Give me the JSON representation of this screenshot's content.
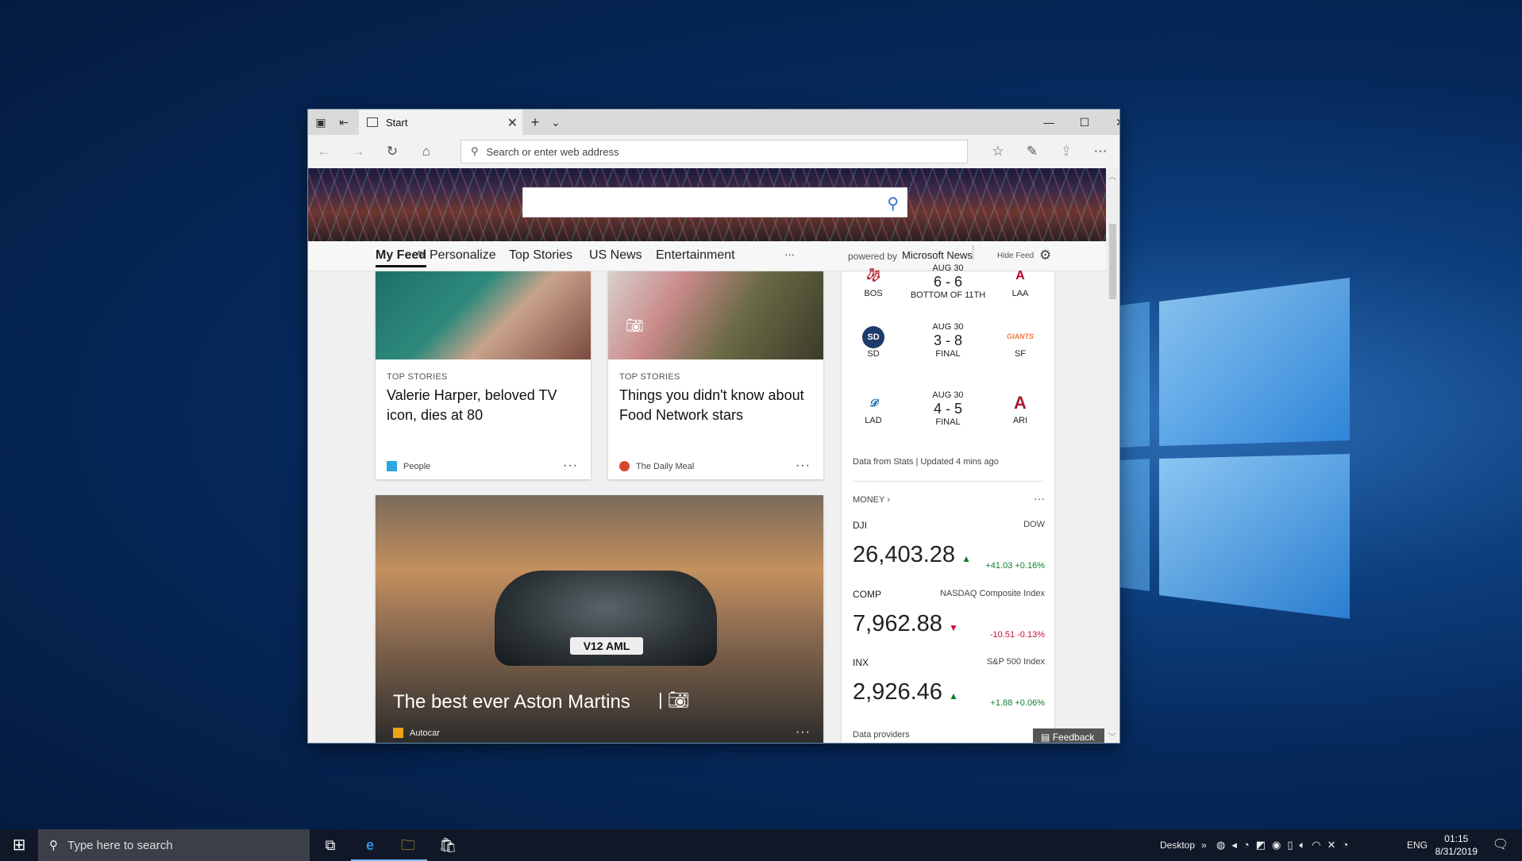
{
  "browser": {
    "tab_title": "Start",
    "address_placeholder": "Search or enter web address",
    "icons": [
      "set-aside-tabs-icon",
      "restore-tabs-icon",
      "new-tab-icon",
      "tab-list-icon",
      "back-icon",
      "forward-icon",
      "refresh-icon",
      "home-icon",
      "favorites-icon",
      "pen-icon",
      "share-icon",
      "more-icon"
    ]
  },
  "feed_nav": {
    "items": [
      "My Feed",
      "Personalize",
      "Top Stories",
      "US News",
      "Entertainment",
      "···"
    ],
    "powered_by": "powered by",
    "brand": "Microsoft News",
    "hide_feed": "Hide Feed"
  },
  "articles": [
    {
      "category": "TOP STORIES",
      "title": "Valerie Harper, beloved TV icon, dies at 80",
      "source": "People"
    },
    {
      "category": "TOP STORIES",
      "title": "Things you didn't know about Food Network stars",
      "source": "The Daily Meal"
    },
    {
      "title": "The best ever Aston Martins",
      "source": "Autocar",
      "plate": "V12 AML"
    }
  ],
  "scores": {
    "games": [
      {
        "away": "BOS",
        "date": "AUG 30",
        "score": "6 - 6",
        "status": "BOTTOM OF 11TH",
        "home": "LAA"
      },
      {
        "away": "SD",
        "date": "AUG 30",
        "score": "3 - 8",
        "status": "FINAL",
        "home": "SF",
        "home_logo_text": "GIANTS"
      },
      {
        "away": "LAD",
        "date": "AUG 30",
        "score": "4 - 5",
        "status": "FINAL",
        "home": "ARI"
      }
    ],
    "footer": "Data from Stats | Updated 4 mins ago"
  },
  "money": {
    "header": "MONEY",
    "stocks": [
      {
        "symbol": "DJI",
        "name": "DOW",
        "price": "26,403.28",
        "direction": "up",
        "change": "+41.03 +0.16%"
      },
      {
        "symbol": "COMP",
        "name": "NASDAQ Composite Index",
        "price": "7,962.88",
        "direction": "down",
        "change": "-10.51 -0.13%"
      },
      {
        "symbol": "INX",
        "name": "S&P 500 Index",
        "price": "2,926.46",
        "direction": "up",
        "change": "+1.88 +0.06%"
      }
    ],
    "providers": "Data providers"
  },
  "feedback_label": "Feedback",
  "taskbar": {
    "search_placeholder": "Type here to search",
    "desktop_label": "Desktop",
    "language": "ENG",
    "time": "01:15",
    "date": "8/31/2019"
  },
  "colors": {
    "accent": "#2a6fd0",
    "up": "#0a7f2e",
    "down": "#c4122f"
  }
}
